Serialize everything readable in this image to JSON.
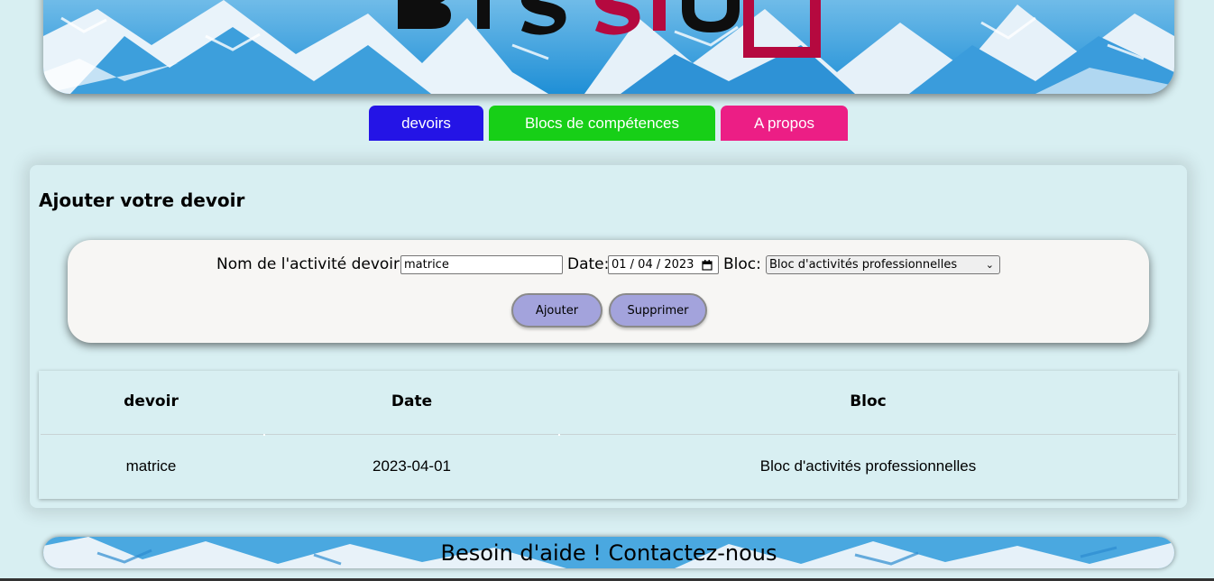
{
  "header": {
    "logo_text": "BTS SIO"
  },
  "nav": {
    "tabs": [
      {
        "label": "devoirs",
        "color": "#2414e6"
      },
      {
        "label": "Blocs de compétences",
        "color": "#17cf17"
      },
      {
        "label": "A propos",
        "color": "#ec1e85"
      }
    ]
  },
  "form_section": {
    "title": "Ajouter votre devoir",
    "name_label": "Nom de l'activité devoir:",
    "name_value": "matrice",
    "date_label": "Date:",
    "date_value": "01 / 04 / 2023",
    "bloc_label": "Bloc:",
    "bloc_selected": "Bloc d'activités professionnelles",
    "add_button": "Ajouter",
    "delete_button": "Supprimer"
  },
  "table": {
    "headers": [
      "devoir",
      "Date",
      "Bloc"
    ],
    "rows": [
      [
        "matrice",
        "2023-04-01",
        "Bloc d'activités professionnelles"
      ]
    ]
  },
  "footer": {
    "text": "Besoin d'aide ! Contactez-nous"
  },
  "colors": {
    "background": "#d8eff2",
    "button": "#a3a3dc",
    "logo_accent": "#b5093f"
  }
}
